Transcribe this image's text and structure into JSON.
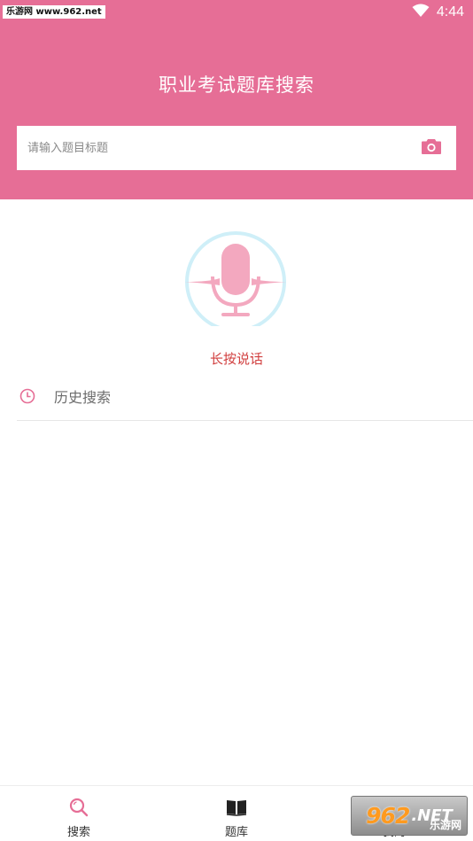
{
  "status_bar": {
    "watermark": "乐游网 www.962.net",
    "time": "4:44"
  },
  "header": {
    "title": "职业考试题库搜索",
    "search_placeholder": "请输入题目标题",
    "background_color": "#e66e96"
  },
  "voice": {
    "label": "长按说话",
    "icon": "microphone-icon",
    "label_color": "#d13f3f"
  },
  "history": {
    "label": "历史搜索",
    "icon": "clock-icon"
  },
  "tabbar": {
    "tabs": [
      {
        "label": "搜索",
        "icon": "search-icon"
      },
      {
        "label": "题库",
        "icon": "book-icon"
      },
      {
        "label": "我的",
        "icon": "user-icon"
      }
    ]
  },
  "watermark_badge": {
    "number": "962",
    "suffix": ".NET",
    "text": "乐游网"
  }
}
